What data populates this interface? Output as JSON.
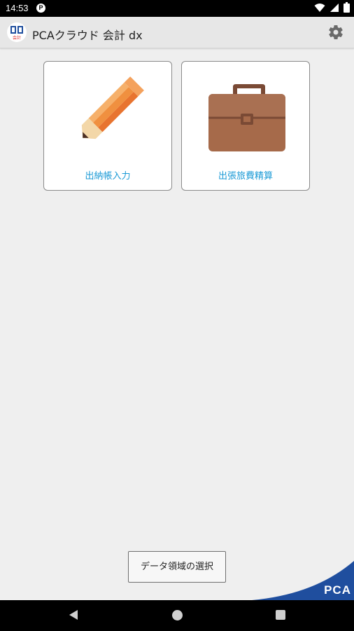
{
  "status_bar": {
    "time": "14:53",
    "indicator": "P",
    "icons": [
      "wifi-icon",
      "signal-icon",
      "battery-icon"
    ]
  },
  "app_bar": {
    "title": "PCAクラウド 会計 dx",
    "logo_text": "会計",
    "settings_icon": "gear-icon"
  },
  "cards": [
    {
      "label": "出納帳入力",
      "icon": "pencil-icon"
    },
    {
      "label": "出張旅費精算",
      "icon": "briefcase-icon"
    }
  ],
  "footer": {
    "select_button_label": "データ領域の選択",
    "brand": "PCA"
  },
  "colors": {
    "accent": "#1a9ad6",
    "brand_blue": "#1f4e9e",
    "background": "#efefef"
  }
}
